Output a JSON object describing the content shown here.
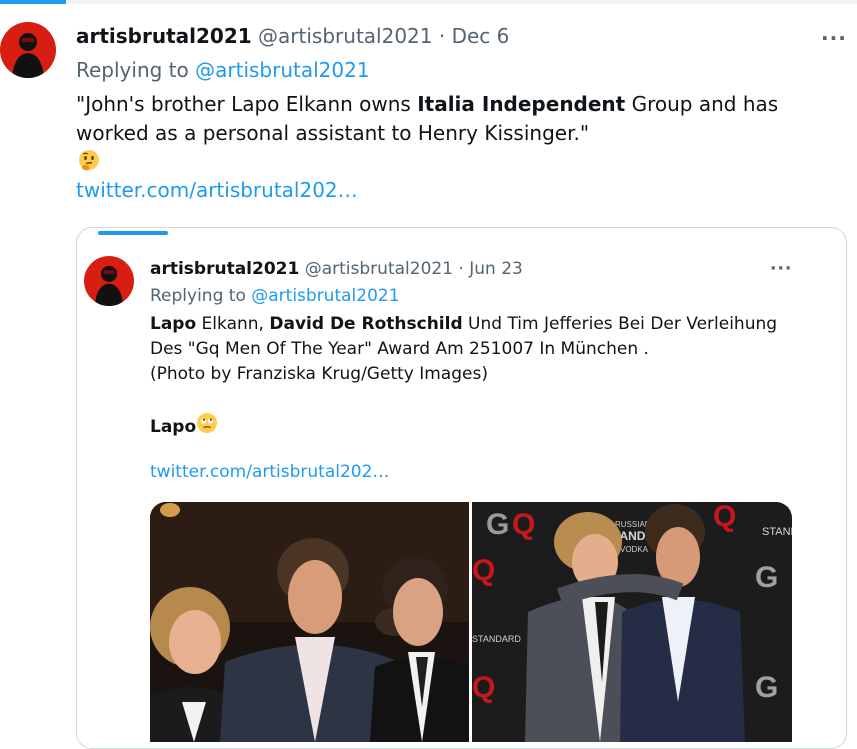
{
  "tweet": {
    "display_name": "artisbrutal2021",
    "handle": "@artisbrutal2021",
    "separator": "·",
    "date": "Dec 6",
    "more_label": "···",
    "replying_prefix": "Replying to",
    "replying_handle": "@artisbrutal2021",
    "text_part1": "\"John's brother Lapo Elkann owns ",
    "text_bold": "Italia Independent",
    "text_part2": " Group and has worked as a personal assistant to Henry Kissinger.\"",
    "emoji": "thinking-face-emoji",
    "link": "twitter.com/artisbrutal202…"
  },
  "quoted": {
    "display_name": "artisbrutal2021",
    "handle": "@artisbrutal2021",
    "separator": "·",
    "date": "Jun 23",
    "more_label": "···",
    "replying_prefix": "Replying to",
    "replying_handle": "@artisbrutal2021",
    "l1_b1": "Lapo",
    "l1_t1": " Elkann, ",
    "l1_b2": "David De Rothschild",
    "l1_t2": " Und Tim Jefferies Bei Der Verleihung",
    "line2": "Des \"Gq Men Of The Year\" Award Am 251007 In München .",
    "line3": "(Photo by  Franziska Krug/Getty Images)",
    "line5_bold": "Lapo",
    "emoji": "face-with-rolling-eyes-emoji",
    "link": "twitter.com/artisbrutal202…",
    "photo_text": {
      "russian1": "RUSSIAN",
      "standard": "STANDARD",
      "vodka": "VODKA",
      "g": "G",
      "q": "Q"
    }
  },
  "colors": {
    "accent": "#1d9bf0",
    "text": "#0f1419",
    "muted": "#536471",
    "border": "#cfd9de"
  }
}
